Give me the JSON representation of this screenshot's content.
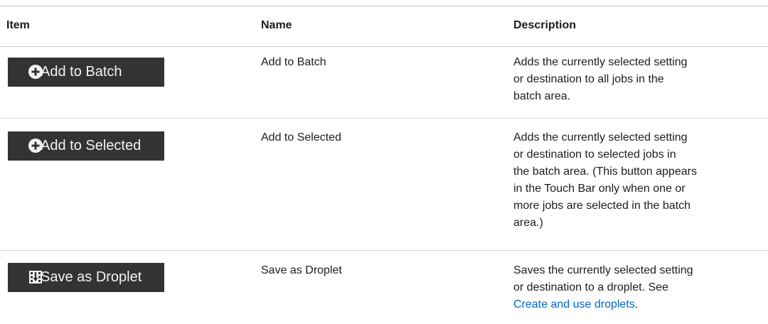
{
  "headers": {
    "item": "Item",
    "name": "Name",
    "description": "Description"
  },
  "rows": [
    {
      "button_label": "Add to Batch",
      "button_icon": "plus-circle-icon",
      "name": "Add to Batch",
      "description_lines": [
        "Adds the currently selected setting",
        "or destination to all jobs in the",
        "batch area."
      ]
    },
    {
      "button_label": "Add to Selected",
      "button_icon": "plus-circle-icon",
      "name": "Add to Selected",
      "description_lines": [
        "Adds the currently selected setting",
        "or destination to selected jobs in",
        "the batch area. (This button appears",
        "in the Touch Bar only when one or",
        "more jobs are selected in the batch",
        "area.)"
      ]
    },
    {
      "button_label": "Save as Droplet",
      "button_icon": "droplet-save-icon",
      "name": "Save as Droplet",
      "description_lines": [
        "Saves the currently selected setting",
        "or destination to a droplet. See"
      ],
      "description_link": "Create and use droplets",
      "description_link_suffix": "."
    }
  ],
  "colors": {
    "button_bg": "#333333",
    "button_text": "#f2f2f2",
    "link": "#0066cc",
    "rule": "#d6d6d6"
  }
}
